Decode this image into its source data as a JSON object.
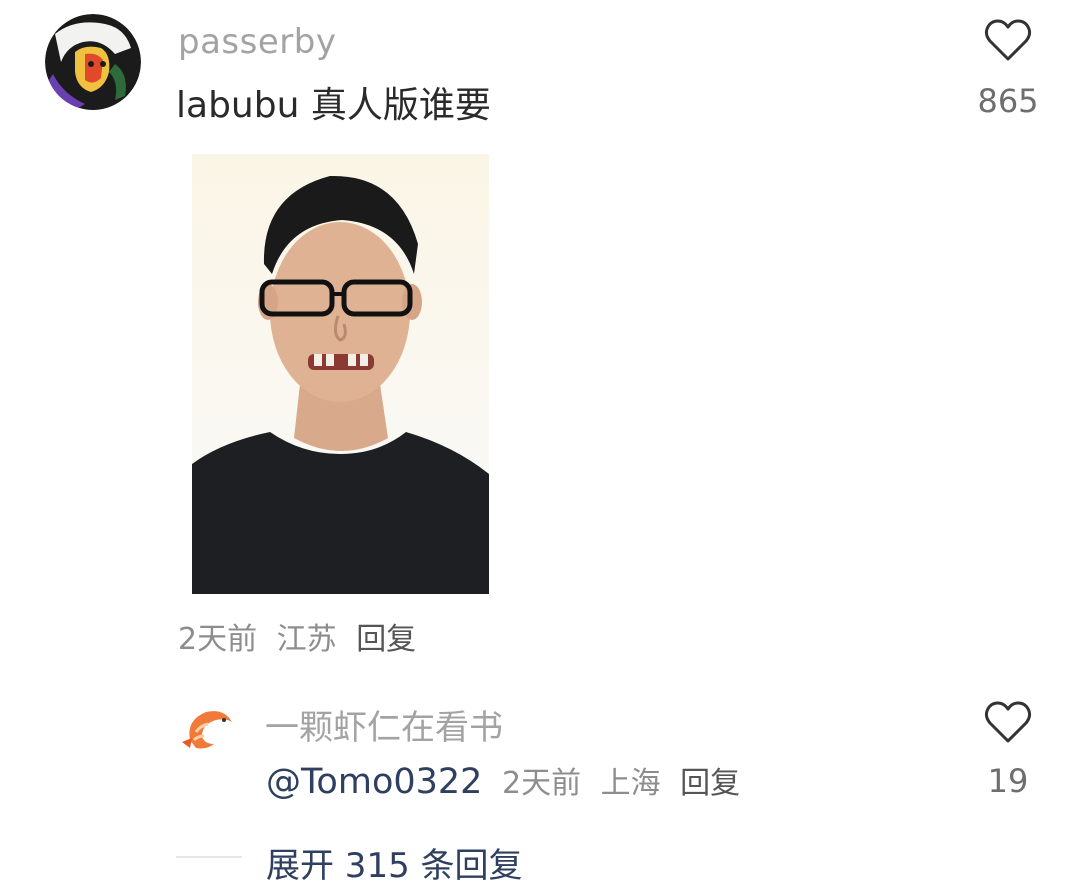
{
  "main_comment": {
    "username": "passerby",
    "text": "labubu 真人版谁要",
    "like_count": "865",
    "time": "2天前",
    "location": "江苏",
    "reply_label": "回复",
    "avatar_icon": "anime-avatar-icon",
    "photo": "person-photo"
  },
  "reply": {
    "username": "一颗虾仁在看书",
    "mention": "@Tomo0322",
    "time": "2天前",
    "location": "上海",
    "reply_label": "回复",
    "like_count": "19",
    "avatar_icon": "shrimp-icon"
  },
  "expand": {
    "label": "展开 315 条回复"
  },
  "colors": {
    "username": "#a3a3a3",
    "meta": "#8d8d8d",
    "link": "#2f3f5f"
  }
}
